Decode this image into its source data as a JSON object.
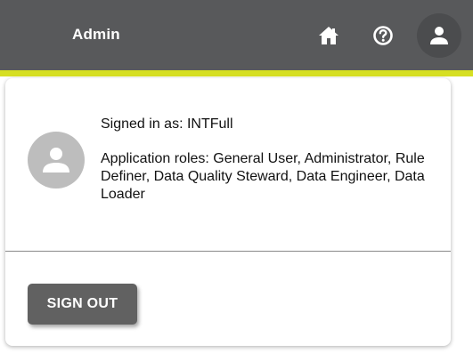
{
  "header": {
    "title": "Admin",
    "icons": {
      "home": "home-icon",
      "help": "help-icon",
      "user": "user-icon"
    },
    "colors": {
      "bar": "#58595b",
      "accent": "#d6df23"
    }
  },
  "user_panel": {
    "avatar_icon": "user-avatar-icon",
    "signed_in_text": "Signed in as: INTFull",
    "roles_text": "Application roles: General User, Administrator, Rule Definer, Data Quality Steward, Data Engineer, Data Loader",
    "sign_out_label": "SIGN OUT"
  }
}
